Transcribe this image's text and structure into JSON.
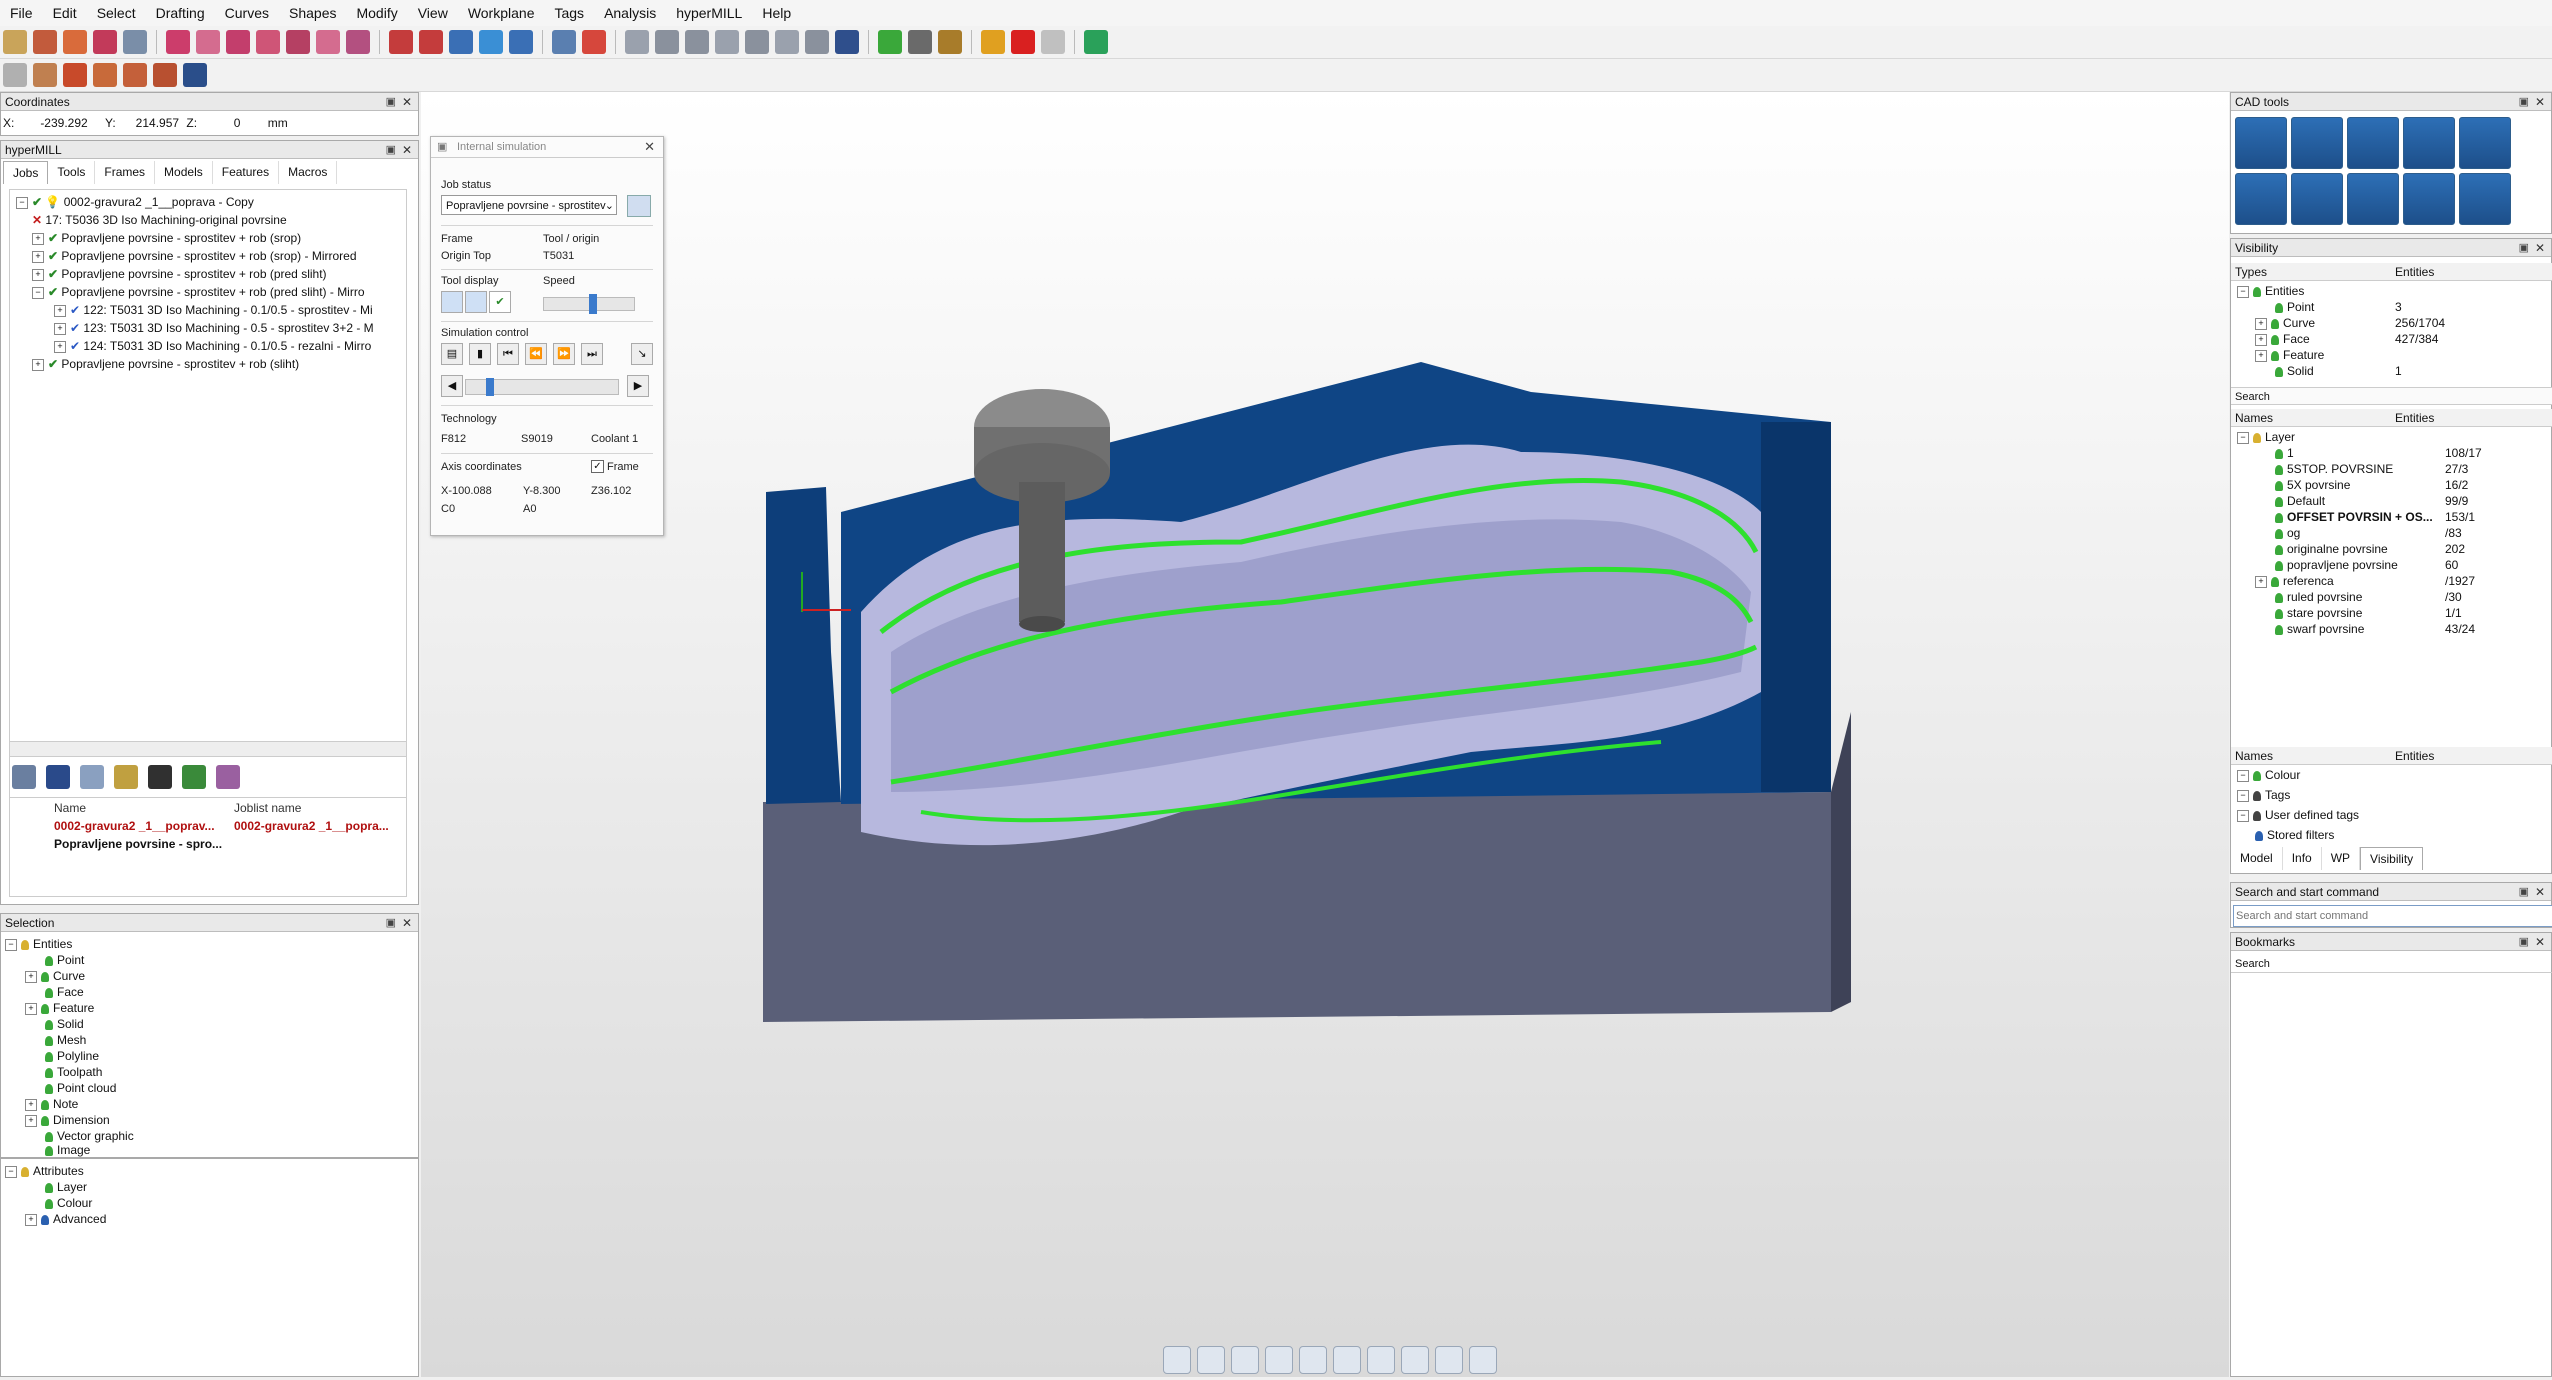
{
  "menu": [
    "File",
    "Edit",
    "Select",
    "Drafting",
    "Curves",
    "Shapes",
    "Modify",
    "View",
    "Workplane",
    "Tags",
    "Analysis",
    "hyperMILL",
    "Help"
  ],
  "coordinates": {
    "title": "Coordinates",
    "x_label": "X:",
    "x_value": "-239.292",
    "y_label": "Y:",
    "y_value": "214.957",
    "z_label": "Z:",
    "z_value": "0",
    "units": "mm"
  },
  "hypermill": {
    "title": "hyperMILL",
    "tabs": [
      "Jobs",
      "Tools",
      "Frames",
      "Models",
      "Features",
      "Macros"
    ],
    "jobs": [
      {
        "id": "root",
        "text": "0002-gravura2 _1__poprava - Copy"
      },
      {
        "id": "j1",
        "text": "17: T5036 3D Iso Machining-original povrsine"
      },
      {
        "id": "j2",
        "text": "Popravljene povrsine - sprostitev + rob (srop)"
      },
      {
        "id": "j3",
        "text": "Popravljene povrsine - sprostitev + rob (srop) - Mirrored"
      },
      {
        "id": "j4",
        "text": "Popravljene povrsine - sprostitev + rob (pred sliht)"
      },
      {
        "id": "j5",
        "text": "Popravljene povrsine - sprostitev + rob (pred sliht) - Mirro"
      },
      {
        "id": "j6",
        "text": "122: T5031 3D Iso Machining - 0.1/0.5 - sprostitev - Mi"
      },
      {
        "id": "j7",
        "text": "123: T5031 3D Iso Machining - 0.5 - sprostitev 3+2 - M"
      },
      {
        "id": "j8",
        "text": "124: T5031 3D Iso Machining - 0.1/0.5 - rezalni - Mirro"
      },
      {
        "id": "j9",
        "text": "Popravljene povrsine - sprostitev + rob (sliht)"
      }
    ],
    "joblist_headers": [
      "Name",
      "Joblist name"
    ],
    "joblist_rows": [
      {
        "name": "0002-gravura2 _1__poprav...",
        "joblist": "0002-gravura2 _1__popra..."
      },
      {
        "name": "Popravljene povrsine - spro...",
        "joblist": ""
      }
    ]
  },
  "selection": {
    "title": "Selection",
    "items": [
      "Entities",
      "Point",
      "Curve",
      "Face",
      "Feature",
      "Solid",
      "Mesh",
      "Polyline",
      "Toolpath",
      "Point cloud",
      "Note",
      "Dimension",
      "Vector graphic",
      "Image"
    ],
    "attributes": [
      "Attributes",
      "Layer",
      "Colour",
      "Advanced"
    ]
  },
  "sim": {
    "title": "Internal simulation",
    "job_status_label": "Job status",
    "job_status_value": "Popravljene povrsine - sprostitev",
    "frame_label": "Frame",
    "frame_value": "Origin Top",
    "tool_origin_label": "Tool / origin",
    "tool_origin_value": "T5031",
    "tool_display_label": "Tool display",
    "speed_label": "Speed",
    "speed_level": 0.55,
    "sim_control_label": "Simulation control",
    "technology_label": "Technology",
    "feed": "F812",
    "spindle": "S9019",
    "coolant": "Coolant  1",
    "axis_label": "Axis coordinates",
    "frame_check": "Frame",
    "x": "X-100.088",
    "y": "Y-8.300",
    "z": "Z36.102",
    "c": "C0",
    "a": "A0"
  },
  "cad_tools": {
    "title": "CAD tools"
  },
  "visibility": {
    "title": "Visibility",
    "headers": [
      "Types",
      "Entities"
    ],
    "types": [
      {
        "name": "Entities",
        "count": ""
      },
      {
        "name": "Point",
        "count": "3"
      },
      {
        "name": "Curve",
        "count": "256/1704"
      },
      {
        "name": "Face",
        "count": "427/384"
      },
      {
        "name": "Feature",
        "count": ""
      },
      {
        "name": "Solid",
        "count": "1"
      }
    ],
    "search_label": "Search",
    "layer_headers": [
      "Names",
      "Entities"
    ],
    "layers": [
      {
        "name": "Layer",
        "count": ""
      },
      {
        "name": "1",
        "count": "108/17"
      },
      {
        "name": "5STOP. POVRSINE",
        "count": "27/3"
      },
      {
        "name": "5X povrsine",
        "count": "16/2"
      },
      {
        "name": "Default",
        "count": "99/9"
      },
      {
        "name": "OFFSET POVRSIN + OS...",
        "count": "153/1"
      },
      {
        "name": "og",
        "count": "/83"
      },
      {
        "name": "originalne povrsine",
        "count": "202"
      },
      {
        "name": "popravljene povrsine",
        "count": "60"
      },
      {
        "name": "referenca",
        "count": "/1927"
      },
      {
        "name": "ruled povrsine",
        "count": "/30"
      },
      {
        "name": "stare povrsine",
        "count": "1/1"
      },
      {
        "name": "swarf povrsine",
        "count": "43/24"
      }
    ],
    "group_headers": [
      "Names",
      "Entities"
    ],
    "groups": [
      "Colour",
      "Tags",
      "User defined tags",
      "Stored filters"
    ],
    "bottom_tabs": [
      "Model",
      "Info",
      "WP",
      "Visibility"
    ]
  },
  "search_cmd": {
    "title": "Search and start command",
    "placeholder": "Search and start command"
  },
  "bookmarks": {
    "title": "Bookmarks",
    "search": "Search"
  },
  "colors": {
    "mold_blue": "#0d3e7a",
    "surface": "#b7b8de",
    "toolpath": "#2ee02e",
    "base": "#5a5f78"
  }
}
